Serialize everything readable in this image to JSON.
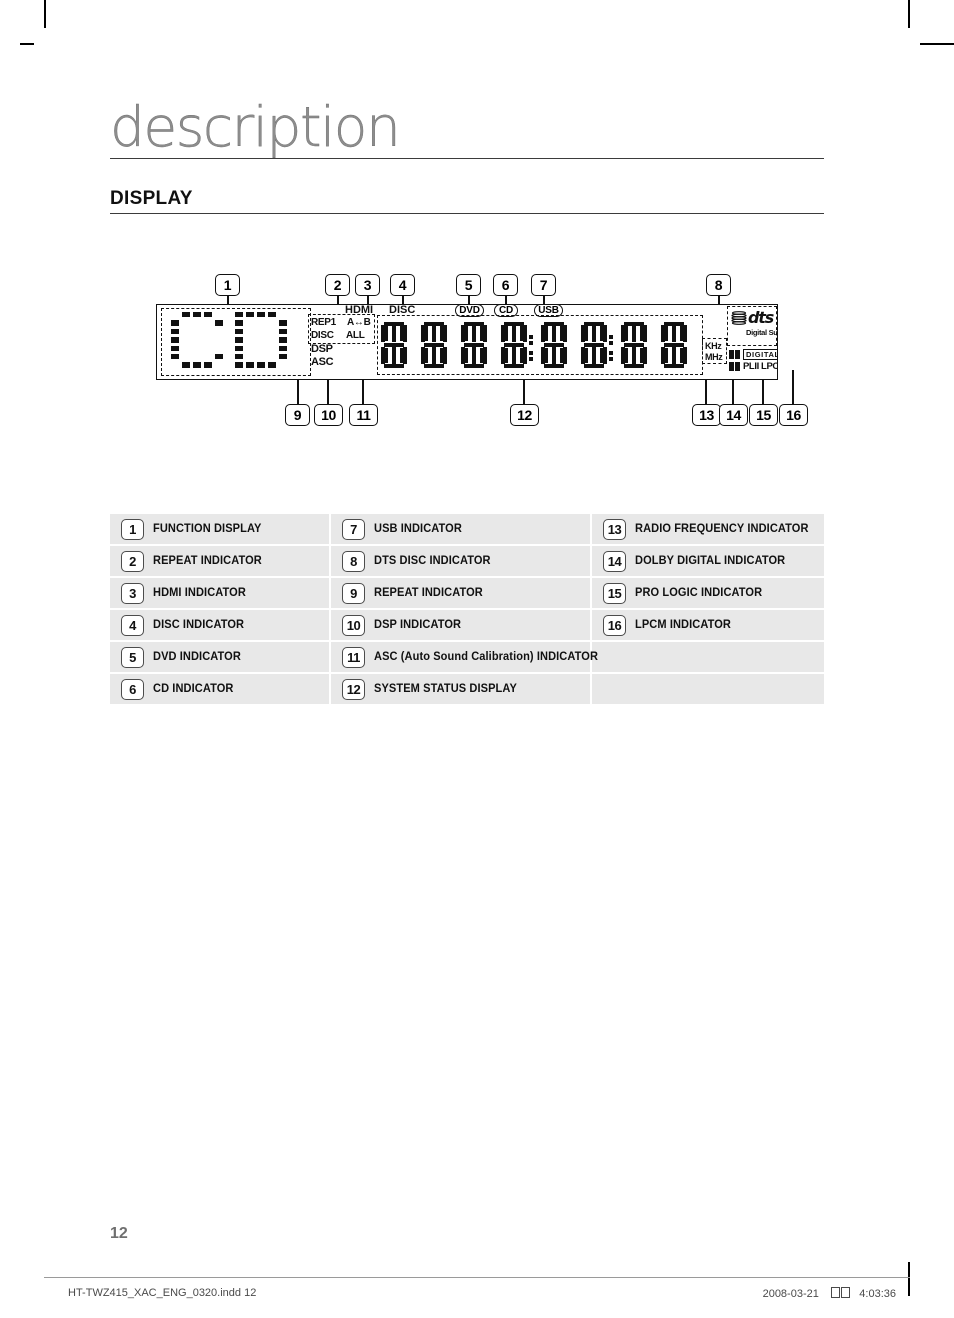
{
  "page": {
    "title": "description",
    "section_heading": "DISPLAY",
    "page_number": "12"
  },
  "figure": {
    "panel_label": "front-panel-display",
    "callouts_top": [
      {
        "n": "1"
      },
      {
        "n": "2"
      },
      {
        "n": "3"
      },
      {
        "n": "4"
      },
      {
        "n": "5"
      },
      {
        "n": "6"
      },
      {
        "n": "7"
      },
      {
        "n": "8"
      }
    ],
    "callouts_bottom": [
      {
        "n": "9"
      },
      {
        "n": "10"
      },
      {
        "n": "11"
      },
      {
        "n": "12"
      },
      {
        "n": "13"
      },
      {
        "n": "14"
      },
      {
        "n": "15"
      },
      {
        "n": "16"
      }
    ],
    "indicators": {
      "function_display_text": "CD",
      "rep1": "REP1",
      "a_b": "A↔B",
      "disc_repeat": "DISC",
      "all": "ALL",
      "dsp": "DSP",
      "asc": "ASC",
      "hdmi": "HDMI",
      "disc": "DISC",
      "dvd": "DVD",
      "cd": "CD",
      "usb": "USB",
      "khz": "KHz",
      "mhz": "MHz",
      "dts_word": "dts",
      "dts_sub": "Digital Surround",
      "dolby_digital": "DIGITAL",
      "plii_lpcm": "PLII LPCM"
    }
  },
  "legend": {
    "rows": [
      {
        "c1": {
          "num": "1",
          "label": "FUNCTION DISPLAY"
        },
        "c2": {
          "num": "7",
          "label": "USB INDICATOR"
        },
        "c3": {
          "num": "13",
          "label": "RADIO FREQUENCY INDICATOR"
        }
      },
      {
        "c1": {
          "num": "2",
          "label": "REPEAT INDICATOR"
        },
        "c2": {
          "num": "8",
          "label": "DTS DISC INDICATOR"
        },
        "c3": {
          "num": "14",
          "label": "DOLBY DIGITAL INDICATOR"
        }
      },
      {
        "c1": {
          "num": "3",
          "label": "HDMI INDICATOR"
        },
        "c2": {
          "num": "9",
          "label": "REPEAT  INDICATOR"
        },
        "c3": {
          "num": "15",
          "label": "PRO LOGIC INDICATOR"
        }
      },
      {
        "c1": {
          "num": "4",
          "label": "DISC INDICATOR"
        },
        "c2": {
          "num": "10",
          "label": "DSP INDICATOR"
        },
        "c3": {
          "num": "16",
          "label": "LPCM INDICATOR"
        }
      },
      {
        "c1": {
          "num": "5",
          "label": "DVD INDICATOR"
        },
        "c2": {
          "num": "11",
          "label": "ASC (Auto Sound Calibration) INDICATOR"
        },
        "c3": {
          "num": "",
          "label": ""
        }
      },
      {
        "c1": {
          "num": "6",
          "label": "CD INDICATOR"
        },
        "c2": {
          "num": "12",
          "label": "SYSTEM STATUS DISPLAY"
        },
        "c3": {
          "num": "",
          "label": ""
        }
      }
    ]
  },
  "footer": {
    "file_name": "HT-TWZ415_XAC_ENG_0320.indd   12",
    "date": "2008-03-21",
    "time": "4:03:36"
  }
}
